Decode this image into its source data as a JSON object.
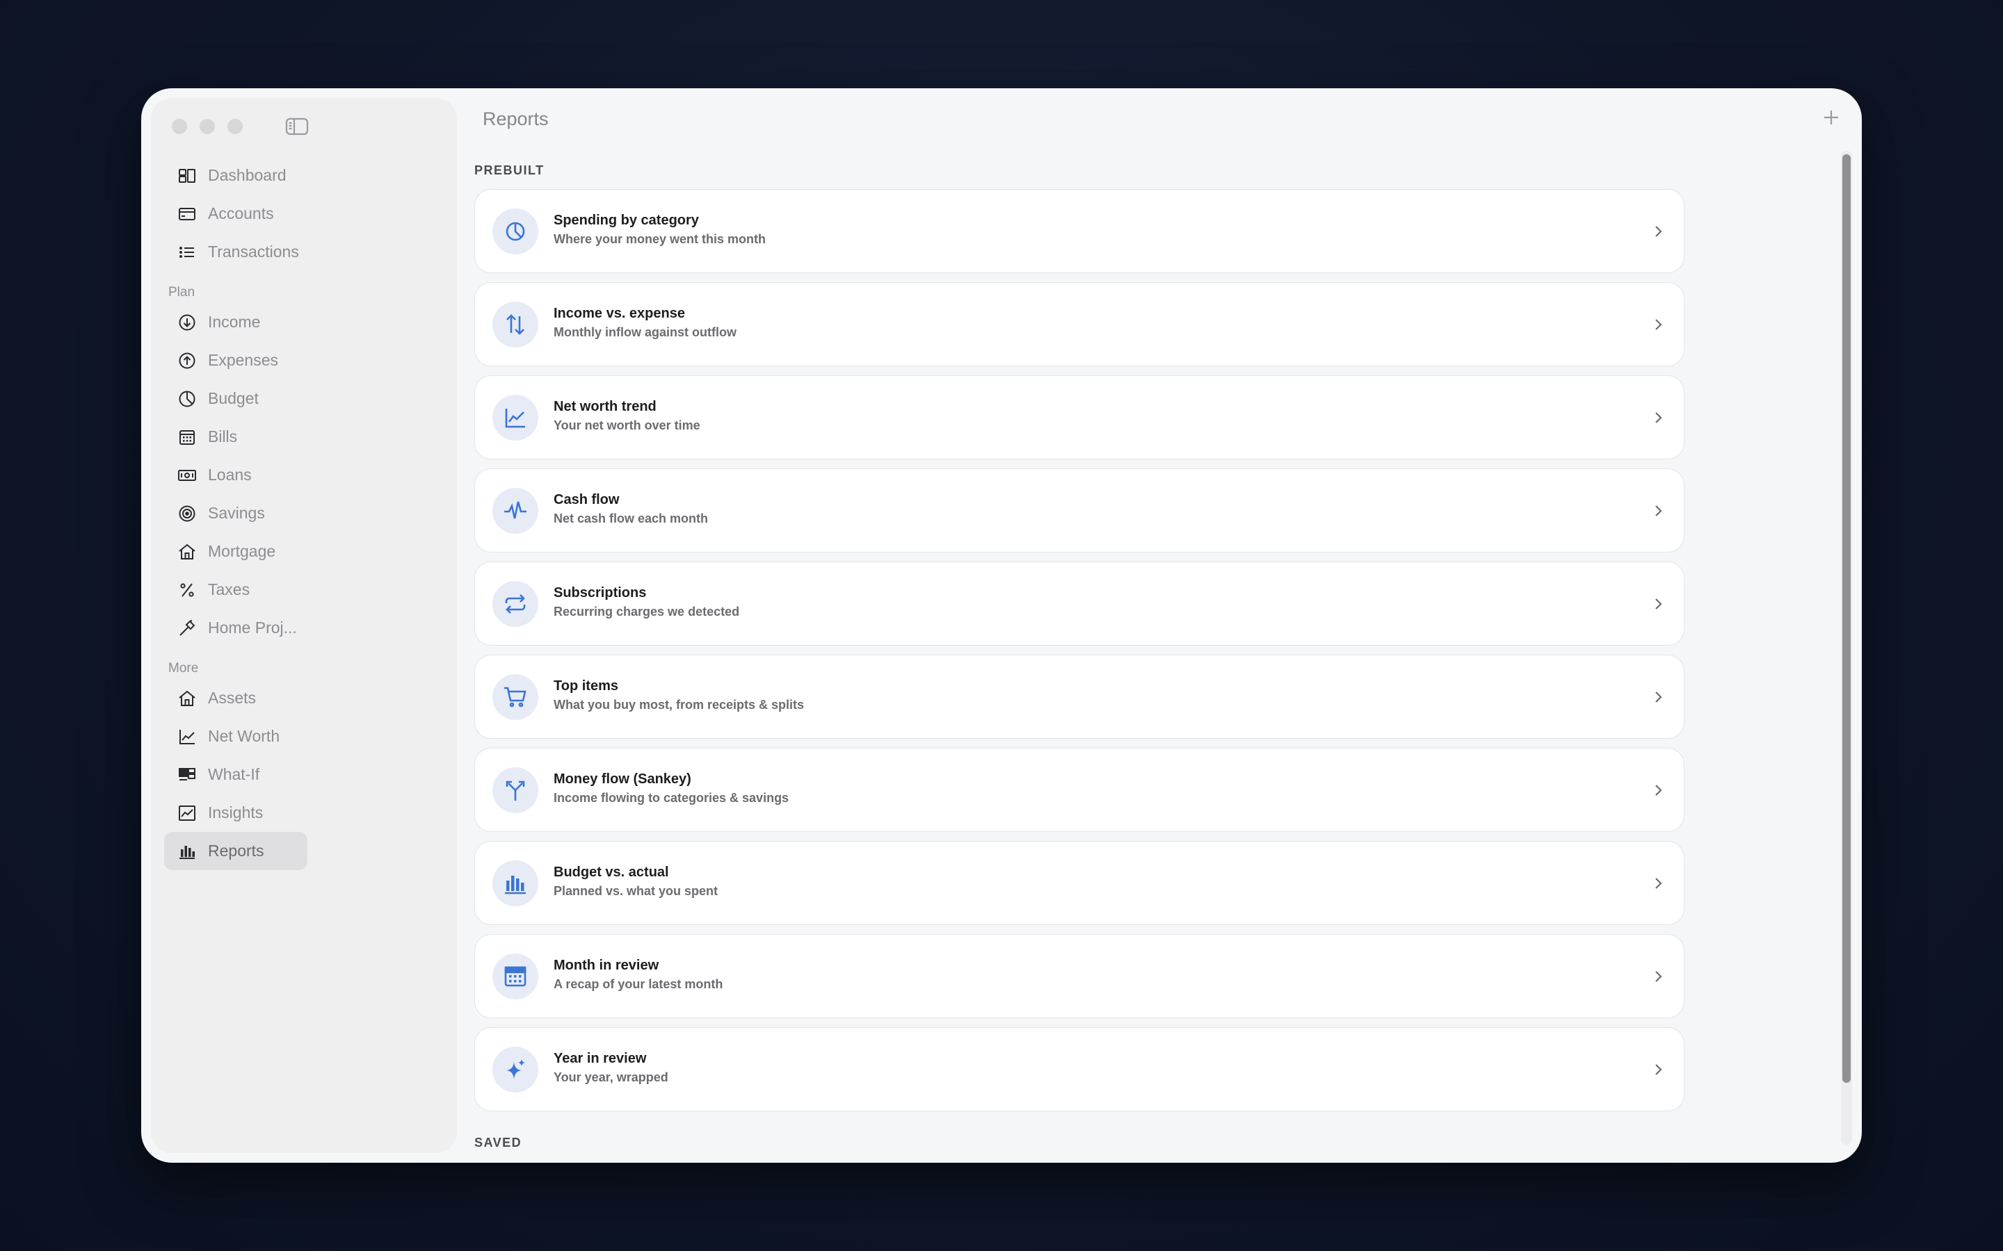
{
  "window": {
    "title": "Reports"
  },
  "sidebar": {
    "top_items": [
      {
        "label": "Dashboard",
        "icon": "dashboard-icon"
      },
      {
        "label": "Accounts",
        "icon": "credit-card-icon"
      },
      {
        "label": "Transactions",
        "icon": "list-icon"
      }
    ],
    "plan_heading": "Plan",
    "plan_items": [
      {
        "label": "Income",
        "icon": "arrow-down-circle-icon"
      },
      {
        "label": "Expenses",
        "icon": "arrow-up-circle-icon"
      },
      {
        "label": "Budget",
        "icon": "pie-chart-icon"
      },
      {
        "label": "Bills",
        "icon": "calendar-icon"
      },
      {
        "label": "Loans",
        "icon": "banknote-icon"
      },
      {
        "label": "Savings",
        "icon": "target-icon"
      },
      {
        "label": "Mortgage",
        "icon": "house-icon"
      },
      {
        "label": "Taxes",
        "icon": "percent-icon"
      },
      {
        "label": "Home Proj...",
        "icon": "hammer-icon"
      }
    ],
    "more_heading": "More",
    "more_items": [
      {
        "label": "Assets",
        "icon": "house-icon"
      },
      {
        "label": "Net Worth",
        "icon": "line-chart-icon"
      },
      {
        "label": "What-If",
        "icon": "compare-icon"
      },
      {
        "label": "Insights",
        "icon": "trend-icon"
      },
      {
        "label": "Reports",
        "icon": "bar-chart-icon",
        "active": true
      }
    ]
  },
  "main": {
    "prebuilt_heading": "PREBUILT",
    "saved_heading": "SAVED",
    "reports": [
      {
        "title": "Spending by category",
        "subtitle": "Where your money went this month",
        "icon": "pie-chart-icon"
      },
      {
        "title": "Income vs. expense",
        "subtitle": "Monthly inflow against outflow",
        "icon": "arrows-up-down-icon"
      },
      {
        "title": "Net worth trend",
        "subtitle": "Your net worth over time",
        "icon": "line-chart-icon"
      },
      {
        "title": "Cash flow",
        "subtitle": "Net cash flow each month",
        "icon": "pulse-icon"
      },
      {
        "title": "Subscriptions",
        "subtitle": "Recurring charges we detected",
        "icon": "repeat-icon"
      },
      {
        "title": "Top items",
        "subtitle": "What you buy most, from receipts & splits",
        "icon": "cart-icon"
      },
      {
        "title": "Money flow (Sankey)",
        "subtitle": "Income flowing to categories & savings",
        "icon": "split-icon"
      },
      {
        "title": "Budget vs. actual",
        "subtitle": "Planned vs. what you spent",
        "icon": "bar-chart-icon"
      },
      {
        "title": "Month in review",
        "subtitle": "A recap of your latest month",
        "icon": "calendar-icon"
      },
      {
        "title": "Year in review",
        "subtitle": "Your year, wrapped",
        "icon": "sparkles-icon"
      }
    ]
  },
  "colors": {
    "accent": "#3a75d3",
    "icon_badge": "#e6ebf6",
    "sidebar_bg": "#efeff0",
    "window_bg": "#f5f6f7"
  }
}
